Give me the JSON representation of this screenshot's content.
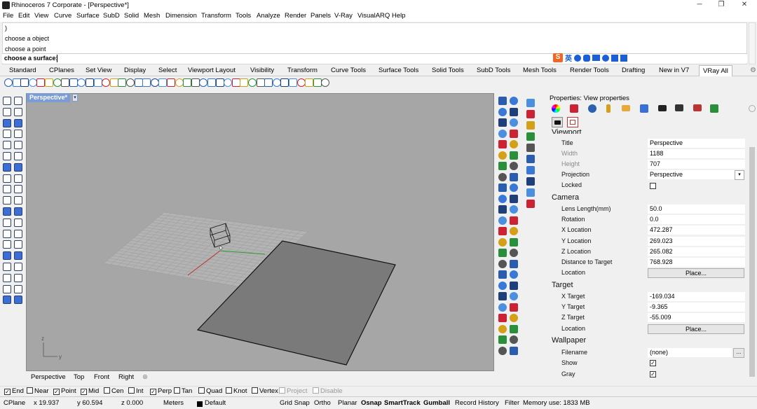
{
  "window": {
    "title": "Rhinoceros 7 Corporate - [Perspective*]",
    "minimize": "─",
    "maximize": "❐",
    "close": "✕"
  },
  "menu": [
    "File",
    "Edit",
    "View",
    "Curve",
    "Surface",
    "SubD",
    "Solid",
    "Mesh",
    "Dimension",
    "Transform",
    "Tools",
    "Analyze",
    "Render",
    "Panels",
    "V-Ray",
    "VisualARQ",
    "Help"
  ],
  "command_history": [
    ")",
    "choose a object",
    "choose a point"
  ],
  "command_prompt": "choose a surface:",
  "ime_label": "英",
  "toolbar_tabs": [
    "Standard",
    "CPlanes",
    "Set View",
    "Display",
    "Select",
    "Viewport Layout",
    "Visibility",
    "Transform",
    "Curve Tools",
    "Surface Tools",
    "Solid Tools",
    "SubD Tools",
    "Mesh Tools",
    "Render Tools",
    "Drafting",
    "New in V7",
    "VRay All"
  ],
  "viewport": {
    "name": "Perspective*",
    "axis_x": "y",
    "axis_z": "z"
  },
  "viewport_tabs": [
    "Perspective",
    "Top",
    "Front",
    "Right",
    "⊕"
  ],
  "properties": {
    "header": "Properties: View properties",
    "viewport_section": "Viewport",
    "rows1": [
      {
        "k": "Title",
        "v": "Perspective"
      },
      {
        "k": "Width",
        "v": "1188"
      },
      {
        "k": "Height",
        "v": "707"
      },
      {
        "k": "Projection",
        "v": "Perspective"
      },
      {
        "k": "Locked",
        "v": ""
      }
    ],
    "camera_section": "Camera",
    "camera": [
      {
        "k": "Lens Length(mm)",
        "v": "50.0"
      },
      {
        "k": "Rotation",
        "v": "0.0"
      },
      {
        "k": "X Location",
        "v": "472.287"
      },
      {
        "k": "Y Location",
        "v": "269.023"
      },
      {
        "k": "Z Location",
        "v": "265.082"
      },
      {
        "k": "Distance to Target",
        "v": "768.928"
      },
      {
        "k": "Location",
        "v": "Place..."
      }
    ],
    "target_section": "Target",
    "target": [
      {
        "k": "X Target",
        "v": "-169.034"
      },
      {
        "k": "Y Target",
        "v": "-9.365"
      },
      {
        "k": "Z Target",
        "v": "-55.009"
      },
      {
        "k": "Location",
        "v": "Place..."
      }
    ],
    "wallpaper_section": "Wallpaper",
    "wallpaper": [
      {
        "k": "Filename",
        "v": "(none)"
      },
      {
        "k": "Show",
        "v": "☑"
      },
      {
        "k": "Gray",
        "v": "☑"
      }
    ],
    "browse": "..."
  },
  "osnap": [
    {
      "label": "End",
      "checked": true
    },
    {
      "label": "Near",
      "checked": false
    },
    {
      "label": "Point",
      "checked": true
    },
    {
      "label": "Mid",
      "checked": true
    },
    {
      "label": "Cen",
      "checked": false
    },
    {
      "label": "Int",
      "checked": false
    },
    {
      "label": "Perp",
      "checked": true
    },
    {
      "label": "Tan",
      "checked": false
    },
    {
      "label": "Quad",
      "checked": false
    },
    {
      "label": "Knot",
      "checked": false
    },
    {
      "label": "Vertex",
      "checked": false
    },
    {
      "label": "Project",
      "checked": false,
      "disabled": true
    },
    {
      "label": "Disable",
      "checked": false,
      "disabled": true
    }
  ],
  "status": {
    "cplane": "CPlane",
    "x": "x 19.937",
    "y": "y 60.594",
    "z": "z 0.000",
    "units": "Meters",
    "layer": "Default",
    "grid_snap": "Grid Snap",
    "ortho": "Ortho",
    "planar": "Planar",
    "osnap": "Osnap",
    "smarttrack": "SmartTrack",
    "gumball": "Gumball",
    "record": "Record History",
    "filter": "Filter",
    "memory": "Memory use: 1833 MB"
  }
}
